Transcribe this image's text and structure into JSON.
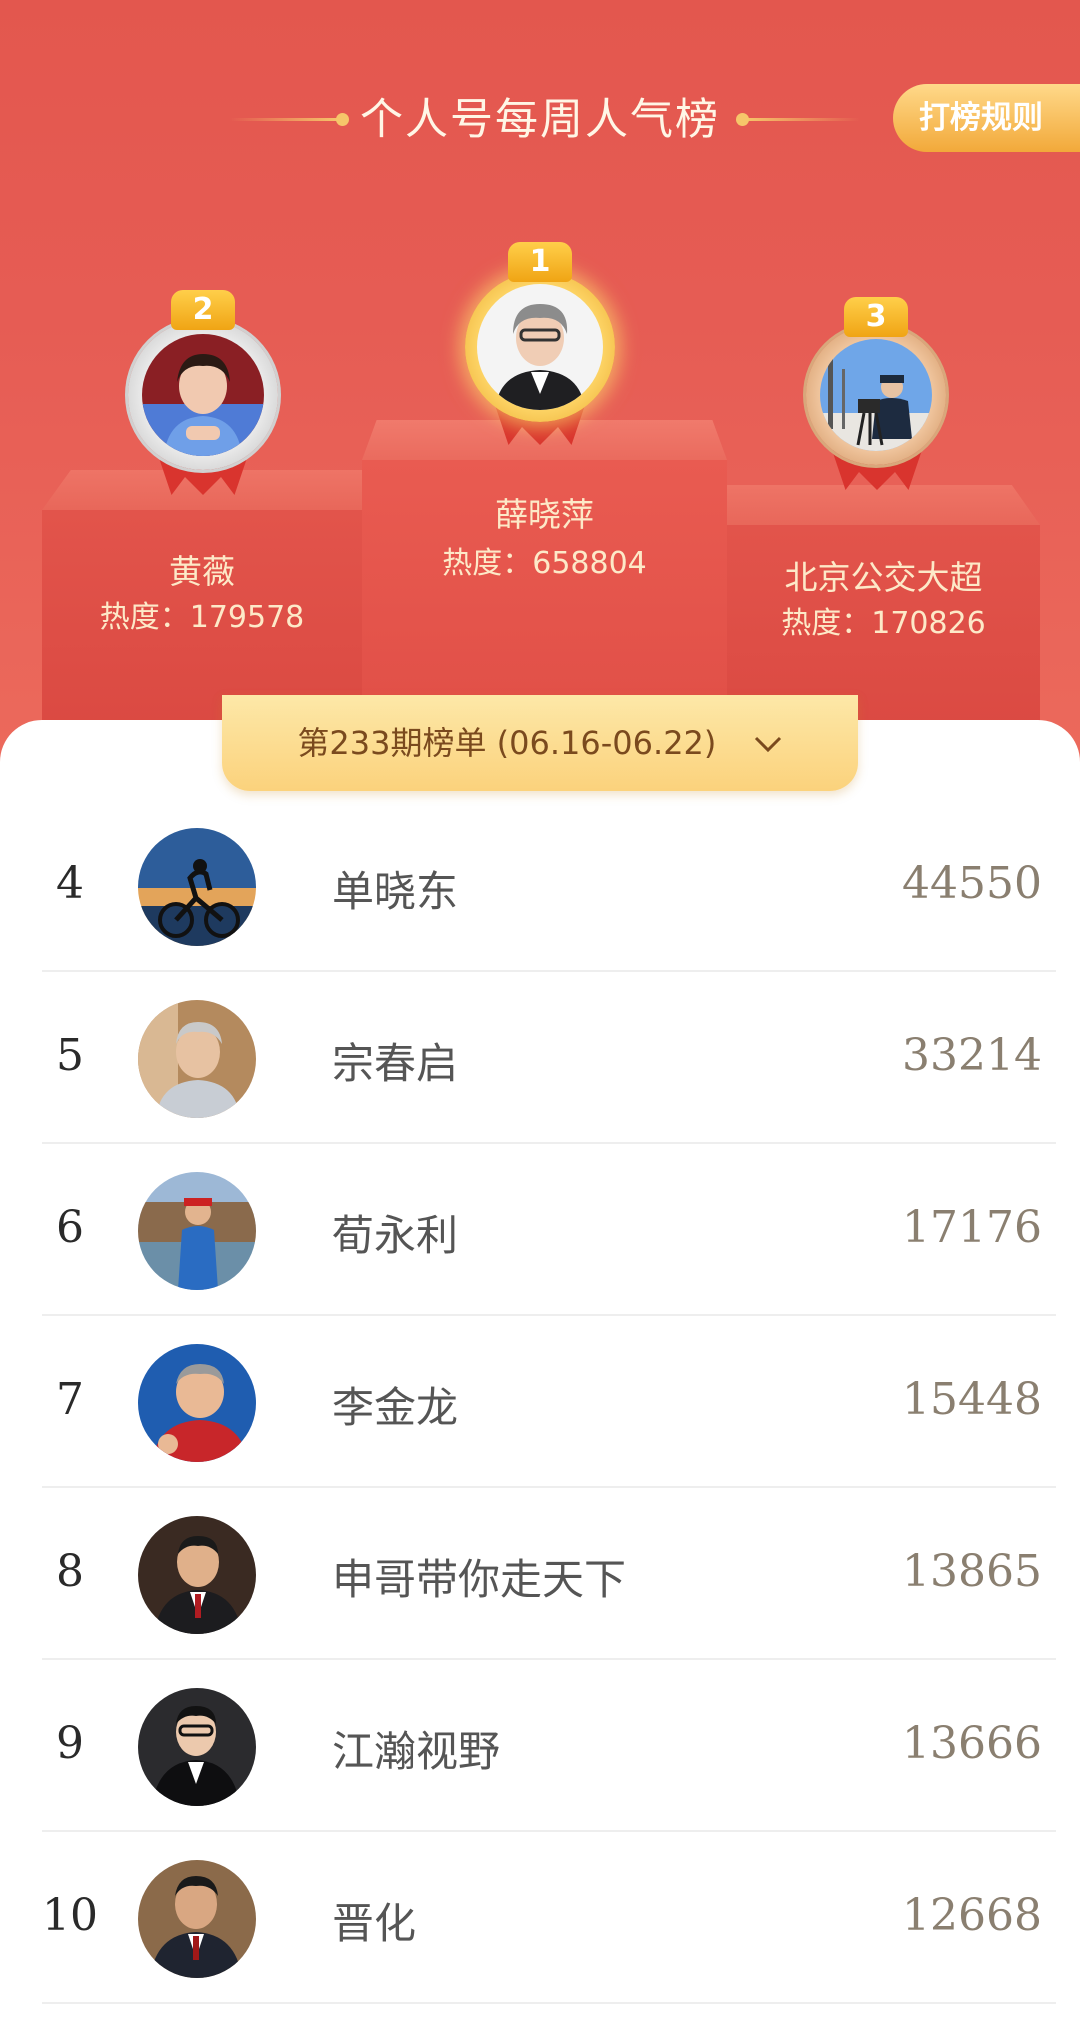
{
  "header": {
    "title": "个人号每周人气榜",
    "rules_button": "打榜规则"
  },
  "podium": [
    {
      "rank": "1",
      "name": "薛晓萍",
      "heat": "热度：658804"
    },
    {
      "rank": "2",
      "name": "黄薇",
      "heat": "热度：179578"
    },
    {
      "rank": "3",
      "name": "北京公交大超",
      "heat": "热度：170826"
    }
  ],
  "period": {
    "label": "第233期榜单 (06.16-06.22)",
    "icon": "chevron-down-icon"
  },
  "ranking": [
    {
      "rank": "4",
      "name": "单晓东",
      "score": "44550"
    },
    {
      "rank": "5",
      "name": "宗春启",
      "score": "33214"
    },
    {
      "rank": "6",
      "name": "荀永利",
      "score": "17176"
    },
    {
      "rank": "7",
      "name": "李金龙",
      "score": "15448"
    },
    {
      "rank": "8",
      "name": "申哥带你走天下",
      "score": "13865"
    },
    {
      "rank": "9",
      "name": "江瀚视野",
      "score": "13666"
    },
    {
      "rank": "10",
      "name": "晋化",
      "score": "12668"
    }
  ],
  "colors": {
    "hero_red": "#e3574e",
    "gold": "#f6c66a",
    "tab_yellow": "#fbd27c"
  }
}
